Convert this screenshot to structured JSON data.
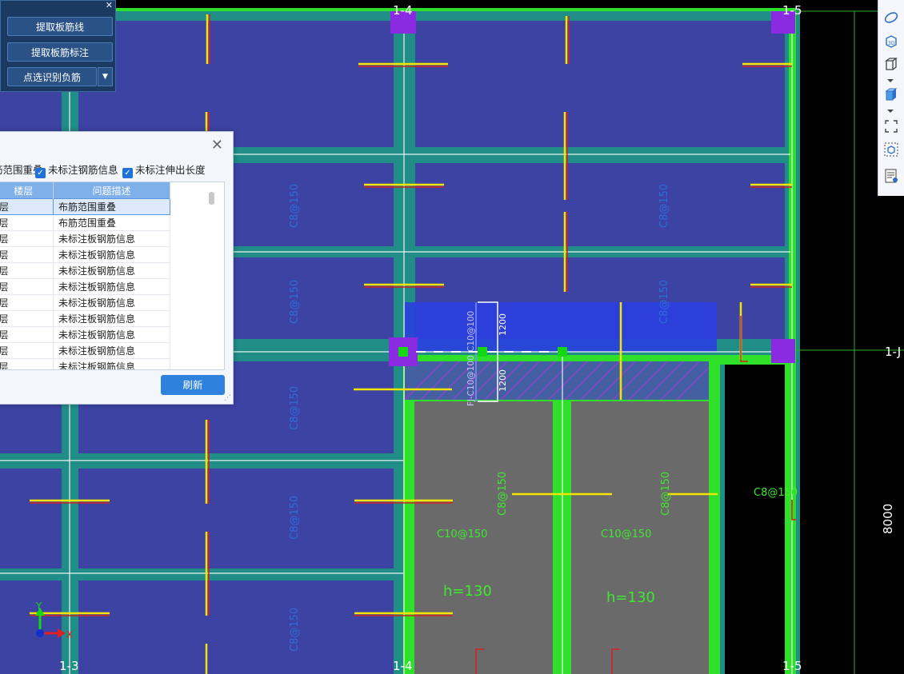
{
  "command_panel": {
    "buttons": [
      "提取板筋线",
      "提取板筋标注",
      "点选识别负筋"
    ]
  },
  "dialog": {
    "filters": [
      "筋范围重叠",
      "未标注钢筋信息",
      "未标注伸出长度"
    ],
    "columns": [
      "楼层",
      "问题描述"
    ],
    "rows": [
      {
        "floor": "层",
        "desc": "布筋范围重叠"
      },
      {
        "floor": "层",
        "desc": "布筋范围重叠"
      },
      {
        "floor": "层",
        "desc": "未标注板钢筋信息"
      },
      {
        "floor": "层",
        "desc": "未标注板钢筋信息"
      },
      {
        "floor": "层",
        "desc": "未标注板钢筋信息"
      },
      {
        "floor": "层",
        "desc": "未标注板钢筋信息"
      },
      {
        "floor": "层",
        "desc": "未标注板钢筋信息"
      },
      {
        "floor": "层",
        "desc": "未标注板钢筋信息"
      },
      {
        "floor": "层",
        "desc": "未标注板钢筋信息"
      },
      {
        "floor": "层",
        "desc": "未标注板钢筋信息"
      },
      {
        "floor": "层",
        "desc": "未标注板钢筋信息"
      }
    ],
    "refresh_label": "刷新"
  },
  "drawing": {
    "grid_labels_top": [
      "1-4",
      "1-5"
    ],
    "grid_labels_bottom": [
      "1-3",
      "1-4",
      "1-5"
    ],
    "grid_label_right": "1-J",
    "dimension": "8000",
    "rebar_labels": [
      "C8@150",
      "C10@150",
      "C10@150",
      "C8@150",
      "C8@150",
      "C8@150",
      "C8@150"
    ],
    "dim_1200": "1200",
    "fj_label": "FJ-C10@100",
    "c10_100": "C10@100",
    "slab_thickness": [
      "h=130",
      "h=130"
    ],
    "axis_x": "X",
    "axis_y": "Y"
  },
  "colors": {
    "slab_blue": "#3d43a3",
    "beam_teal": "#208e86",
    "slab_green": "#2fe02a",
    "slab_gray": "#6a6a6a",
    "rebar_yellow": "#f5e400",
    "rebar_red": "#d42020",
    "label_blue": "#2a6fd4",
    "label_green": "#3fe830",
    "column_purple": "#8a2be2"
  },
  "toolbar": {
    "icons": [
      "orbit-icon",
      "view-3d-icon",
      "cube-view-icon",
      "solid-cube-icon",
      "fit-extents-icon",
      "box-select-icon",
      "layer-list-icon"
    ]
  }
}
